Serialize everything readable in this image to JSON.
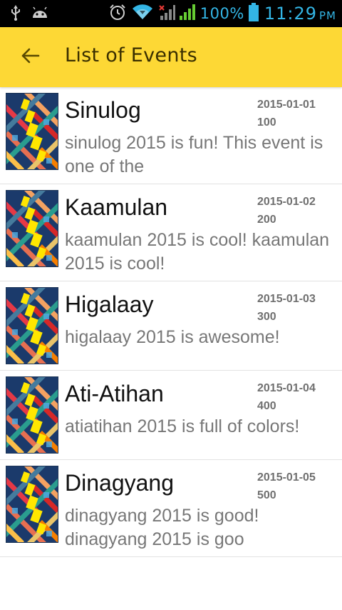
{
  "status_bar": {
    "battery": "100%",
    "time": "11:29",
    "ampm": "PM"
  },
  "app_bar": {
    "title": "List of Events"
  },
  "events": [
    {
      "title": "Sinulog",
      "date": "2015-01-01",
      "number": "100",
      "description": "sinulog 2015 is fun! This event is one of the"
    },
    {
      "title": "Kaamulan",
      "date": "2015-01-02",
      "number": "200",
      "description": "kaamulan 2015 is cool! kaamulan 2015 is cool!"
    },
    {
      "title": "Higalaay",
      "date": "2015-01-03",
      "number": "300",
      "description": "higalaay 2015 is awesome!"
    },
    {
      "title": "Ati-Atihan",
      "date": "2015-01-04",
      "number": "400",
      "description": "atiatihan 2015 is full of colors!"
    },
    {
      "title": "Dinagyang",
      "date": "2015-01-05",
      "number": "500",
      "description": "dinagyang 2015 is good! dinagyang 2015 is goo"
    }
  ],
  "colors": {
    "app_bar": "#fdd835",
    "status_text": "#33b5e5",
    "signal_green": "#66cc33"
  }
}
